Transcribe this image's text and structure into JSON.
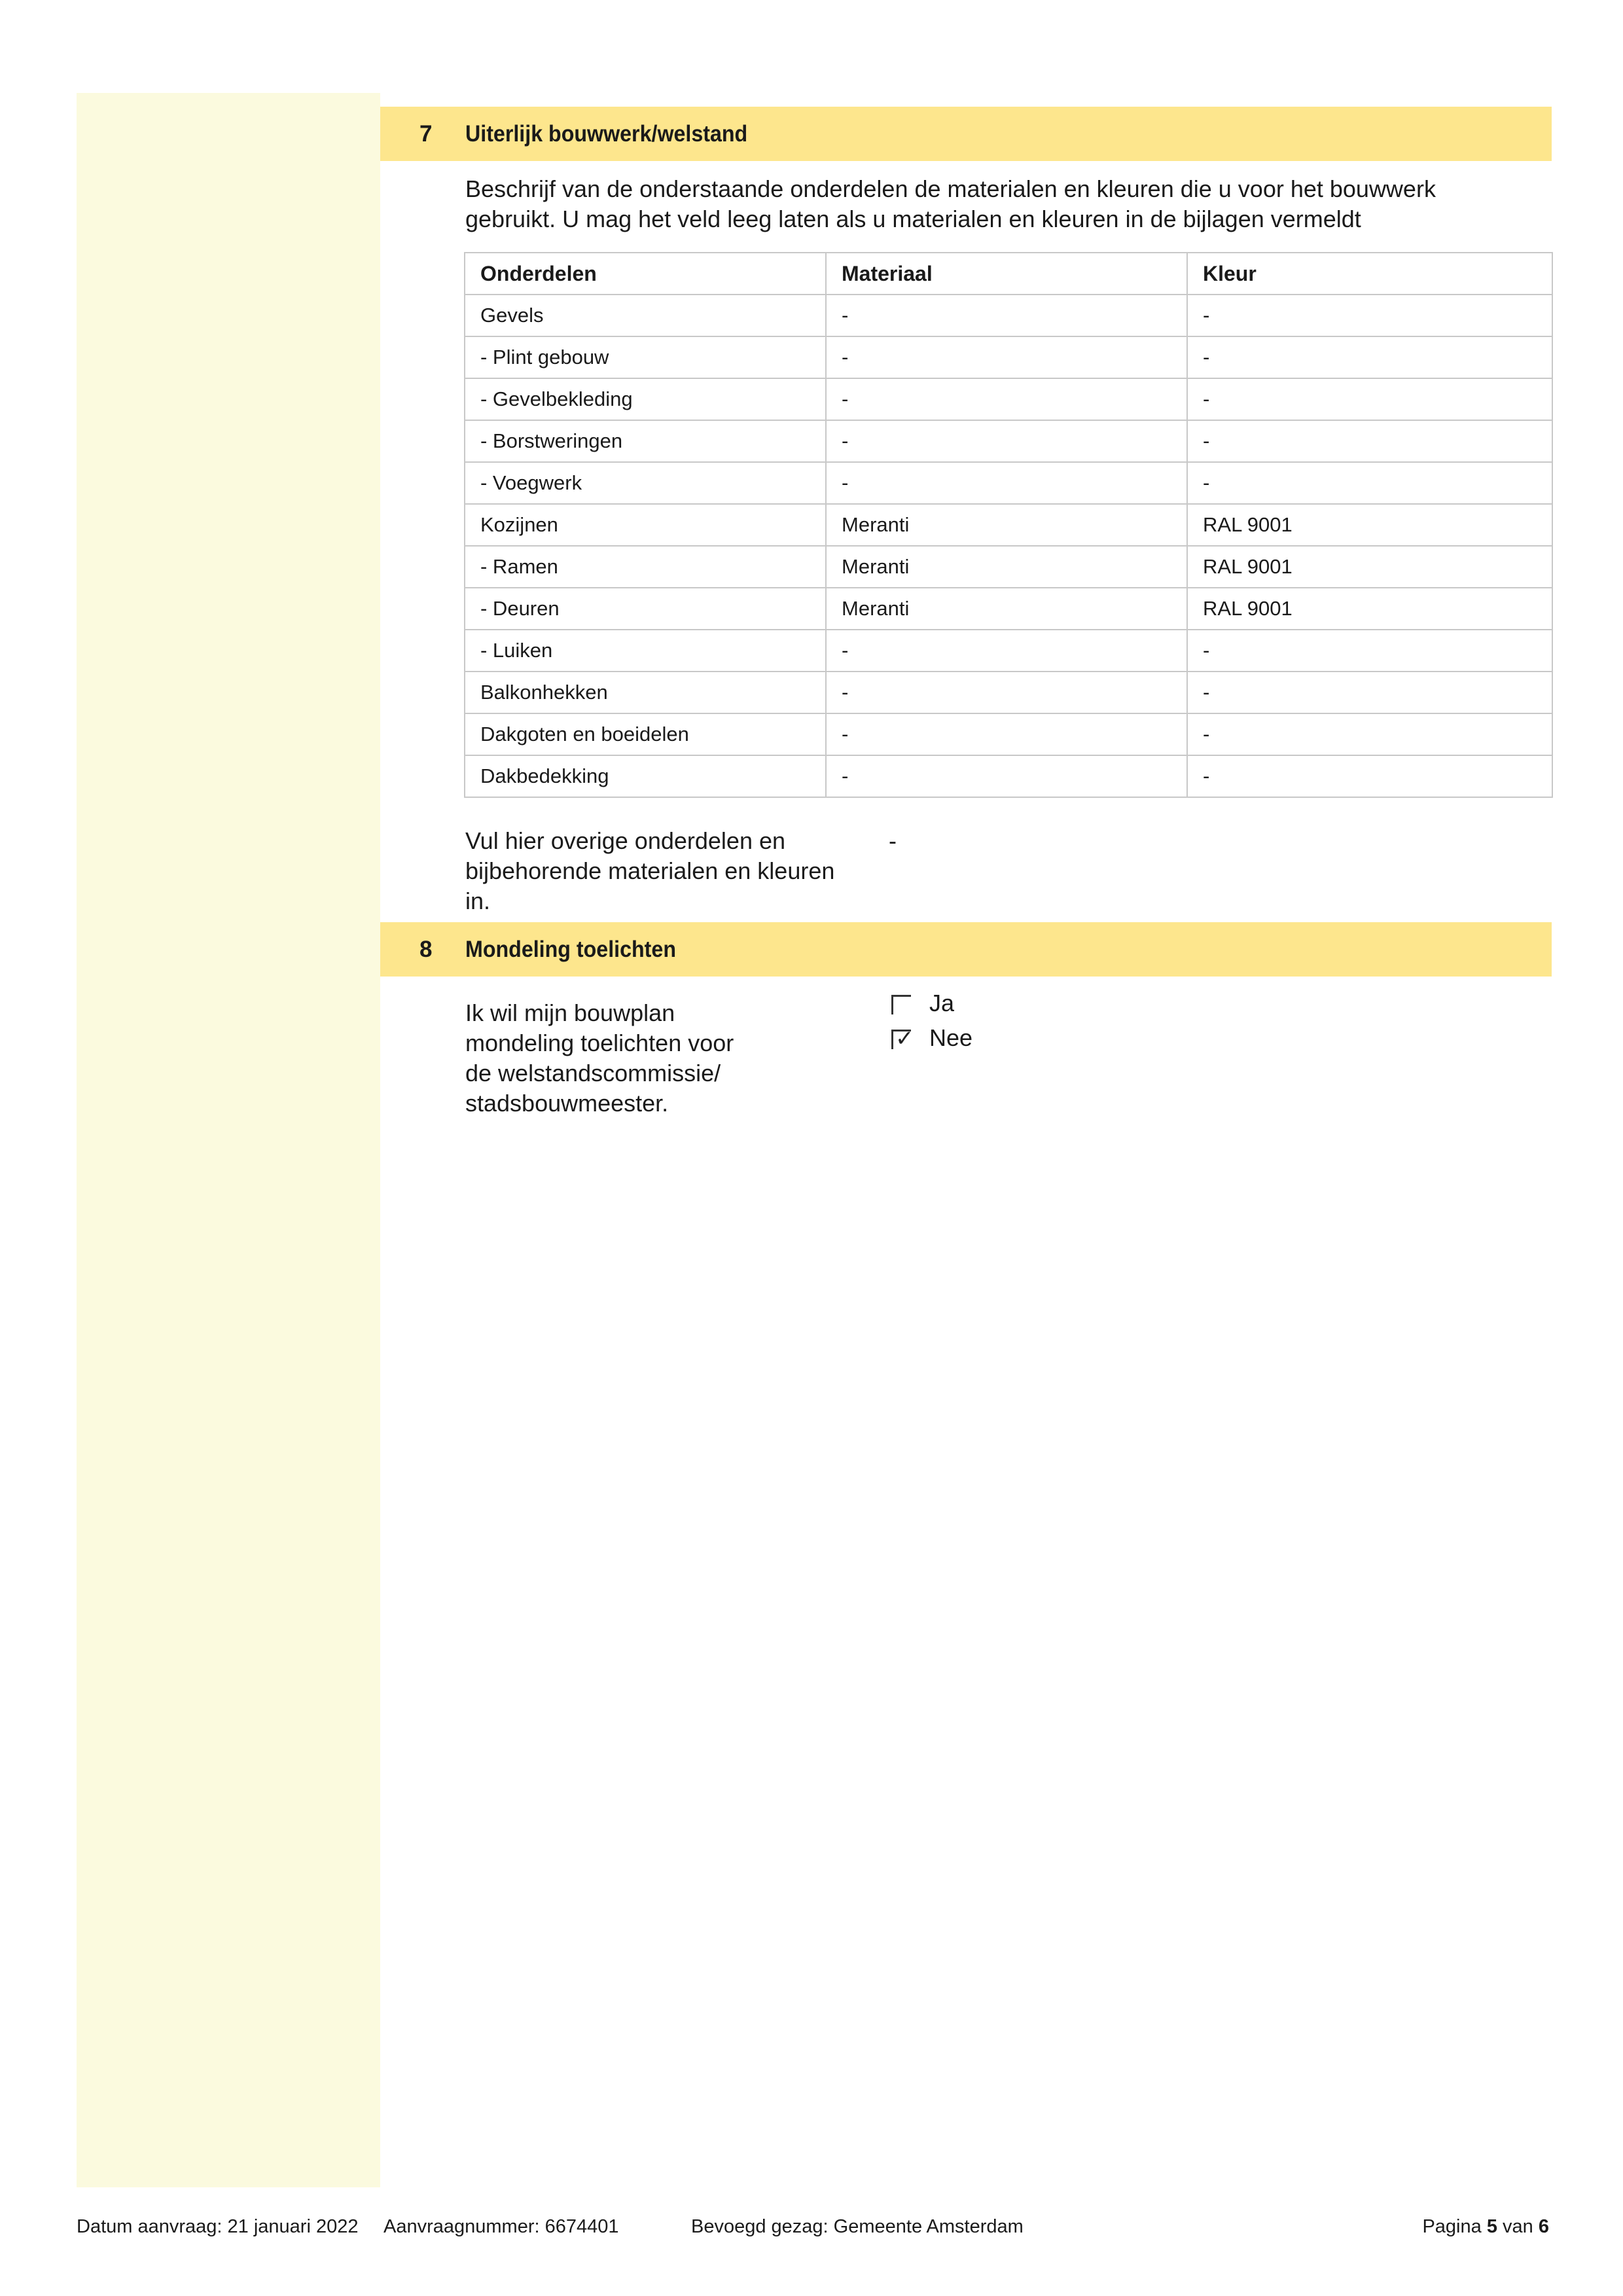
{
  "section7": {
    "number": "7",
    "title": "Uiterlijk bouwwerk/welstand",
    "intro_line1": "Beschrijf van de onderstaande onderdelen de materialen en kleuren die u voor het bouwwerk",
    "intro_line2": "gebruikt. U mag het veld leeg laten als u materialen en kleuren in de bijlagen vermeldt",
    "table": {
      "headers": [
        "Onderdelen",
        "Materiaal",
        "Kleur"
      ],
      "rows": [
        [
          "Gevels",
          "-",
          "-"
        ],
        [
          "- Plint gebouw",
          "-",
          "-"
        ],
        [
          "- Gevelbekleding",
          "-",
          "-"
        ],
        [
          "- Borstweringen",
          "-",
          "-"
        ],
        [
          "- Voegwerk",
          "-",
          "-"
        ],
        [
          "Kozijnen",
          "Meranti",
          "RAL 9001"
        ],
        [
          "- Ramen",
          "Meranti",
          "RAL 9001"
        ],
        [
          "- Deuren",
          "Meranti",
          "RAL 9001"
        ],
        [
          "- Luiken",
          "-",
          "-"
        ],
        [
          "Balkonhekken",
          "-",
          "-"
        ],
        [
          "Dakgoten en boeidelen",
          "-",
          "-"
        ],
        [
          "Dakbedekking",
          "-",
          "-"
        ]
      ]
    },
    "other_label_line1": "Vul hier overige onderdelen en",
    "other_label_line2": "bijbehorende materialen en kleuren",
    "other_label_line3": "in.",
    "other_value": "-"
  },
  "section8": {
    "number": "8",
    "title": "Mondeling toelichten",
    "label_line1": "Ik wil mijn bouwplan",
    "label_line2": "mondeling toelichten voor",
    "label_line3": "de welstandscommissie/",
    "label_line4": "stadsbouwmeester.",
    "options": [
      {
        "label": "Ja",
        "checked": false
      },
      {
        "label": "Nee",
        "checked": true,
        "mark": "✓"
      }
    ]
  },
  "footer": {
    "date": "Datum aanvraag: 21 januari 2022",
    "request_number": "Aanvraagnummer: 6674401",
    "authority": "Bevoegd gezag: Gemeente Amsterdam",
    "page_prefix": "Pagina",
    "page_current": "5",
    "page_sep": "van",
    "page_total": "6"
  },
  "colors": {
    "side_band": "#fbfade",
    "section_bar": "#fde68d",
    "table_border": "#c8c8c8"
  }
}
